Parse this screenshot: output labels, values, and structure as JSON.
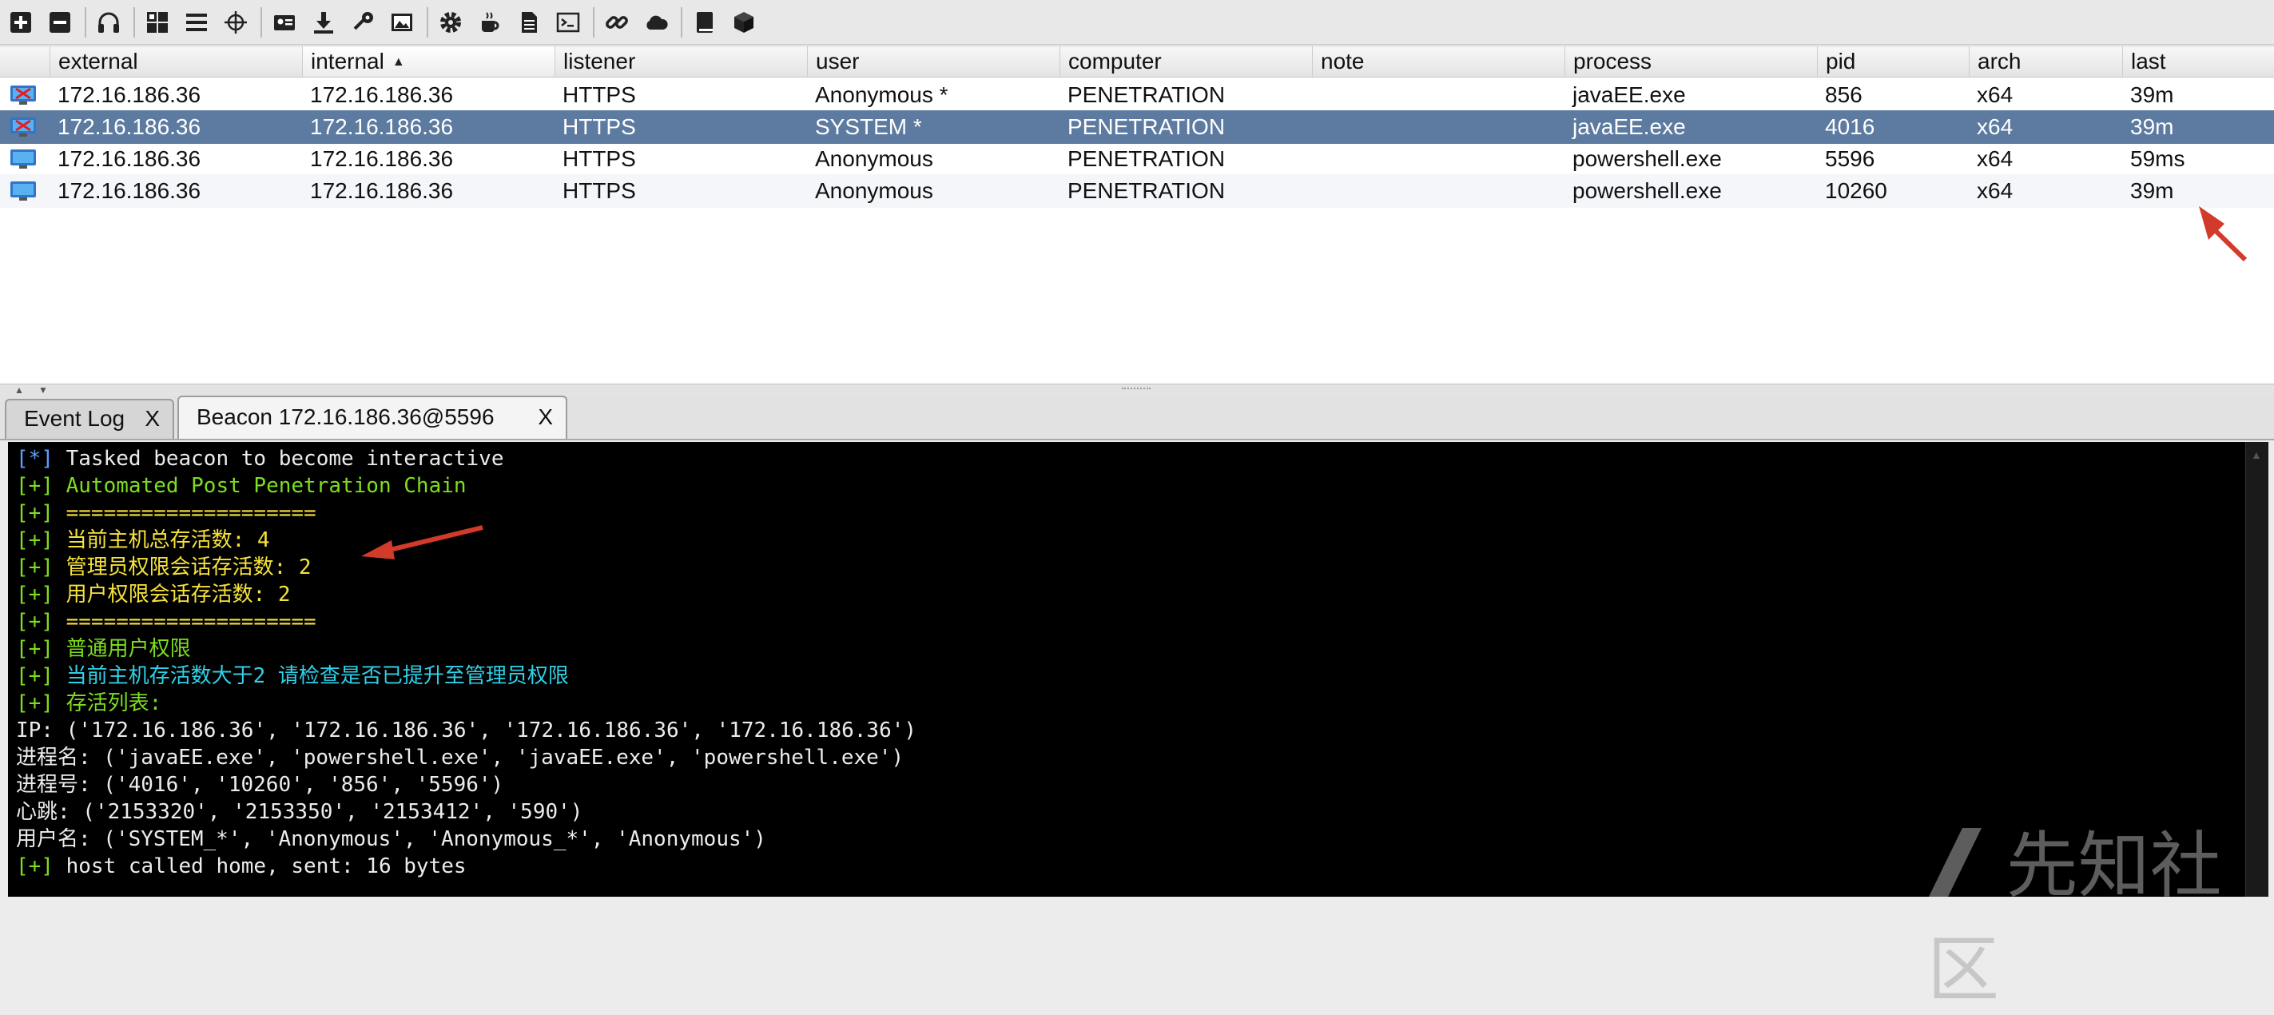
{
  "toolbar": {
    "buttons": [
      {
        "name": "new-connection-icon"
      },
      {
        "name": "disconnect-icon"
      },
      {
        "name": "headphones-icon"
      },
      {
        "name": "pivot-graph-icon"
      },
      {
        "name": "session-table-icon"
      },
      {
        "name": "targets-crosshair-icon"
      },
      {
        "name": "credentials-icon"
      },
      {
        "name": "downloads-icon"
      },
      {
        "name": "keystrokes-key-icon"
      },
      {
        "name": "screenshots-icon"
      },
      {
        "name": "payload-generator-gear-icon"
      },
      {
        "name": "java-cup-icon"
      },
      {
        "name": "document-icon"
      },
      {
        "name": "terminal-icon"
      },
      {
        "name": "link-icon"
      },
      {
        "name": "cloud-icon"
      },
      {
        "name": "book-icon"
      },
      {
        "name": "package-cube-icon"
      }
    ]
  },
  "table": {
    "columns": [
      "external",
      "internal",
      "listener",
      "user",
      "computer",
      "note",
      "process",
      "pid",
      "arch",
      "last"
    ],
    "sorted_column": "internal",
    "rows": [
      {
        "external": "172.16.186.36",
        "internal": "172.16.186.36",
        "listener": "HTTPS",
        "user": "Anonymous *",
        "computer": "PENETRATION",
        "note": "",
        "process": "javaEE.exe",
        "pid": "856",
        "arch": "x64",
        "last": "39m",
        "selected": false,
        "elevated": true
      },
      {
        "external": "172.16.186.36",
        "internal": "172.16.186.36",
        "listener": "HTTPS",
        "user": "SYSTEM *",
        "computer": "PENETRATION",
        "note": "",
        "process": "javaEE.exe",
        "pid": "4016",
        "arch": "x64",
        "last": "39m",
        "selected": true,
        "elevated": true
      },
      {
        "external": "172.16.186.36",
        "internal": "172.16.186.36",
        "listener": "HTTPS",
        "user": "Anonymous",
        "computer": "PENETRATION",
        "note": "",
        "process": "powershell.exe",
        "pid": "5596",
        "arch": "x64",
        "last": "59ms",
        "selected": false,
        "elevated": false
      },
      {
        "external": "172.16.186.36",
        "internal": "172.16.186.36",
        "listener": "HTTPS",
        "user": "Anonymous",
        "computer": "PENETRATION",
        "note": "",
        "process": "powershell.exe",
        "pid": "10260",
        "arch": "x64",
        "last": "39m",
        "selected": false,
        "elevated": false
      }
    ]
  },
  "tabs": [
    {
      "label": "Event Log",
      "close": "X",
      "active": false
    },
    {
      "label": "Beacon 172.16.186.36@5596",
      "close": "X",
      "active": true
    }
  ],
  "console": {
    "lines": [
      {
        "prefix": "[*]",
        "text": " Tasked beacon to become interactive",
        "prefix_color": "blue",
        "text_color": "white"
      },
      {
        "prefix": "[+]",
        "text": " Automated Post Penetration Chain",
        "prefix_color": "green",
        "text_color": "green"
      },
      {
        "prefix": "[+]",
        "text": " ====================",
        "prefix_color": "green",
        "text_color": "yellow"
      },
      {
        "prefix": "[+]",
        "text": " 当前主机总存活数: 4",
        "prefix_color": "green",
        "text_color": "yellow"
      },
      {
        "prefix": "[+]",
        "text": " 管理员权限会话存活数: 2",
        "prefix_color": "green",
        "text_color": "yellow"
      },
      {
        "prefix": "[+]",
        "text": " 用户权限会话存活数: 2",
        "prefix_color": "green",
        "text_color": "yellow"
      },
      {
        "prefix": "[+]",
        "text": " ====================",
        "prefix_color": "green",
        "text_color": "yellow"
      },
      {
        "prefix": "[+]",
        "text": " 普通用户权限",
        "prefix_color": "green",
        "text_color": "green"
      },
      {
        "prefix": "[+]",
        "text": " 当前主机存活数大于2 请检查是否已提升至管理员权限",
        "prefix_color": "green",
        "text_color": "cyan"
      },
      {
        "prefix": "[+]",
        "text": " 存活列表:",
        "prefix_color": "green",
        "text_color": "green"
      },
      {
        "prefix": "",
        "text": "IP: ('172.16.186.36', '172.16.186.36', '172.16.186.36', '172.16.186.36')",
        "prefix_color": "white",
        "text_color": "white"
      },
      {
        "prefix": "",
        "text": "进程名: ('javaEE.exe', 'powershell.exe', 'javaEE.exe', 'powershell.exe')",
        "prefix_color": "white",
        "text_color": "white"
      },
      {
        "prefix": "",
        "text": "进程号: ('4016', '10260', '856', '5596')",
        "prefix_color": "white",
        "text_color": "white"
      },
      {
        "prefix": "",
        "text": "心跳: ('2153320', '2153350', '2153412', '590')",
        "prefix_color": "white",
        "text_color": "white"
      },
      {
        "prefix": "",
        "text": "用户名: ('SYSTEM_*', 'Anonymous', 'Anonymous_*', 'Anonymous')",
        "prefix_color": "white",
        "text_color": "white"
      },
      {
        "prefix": "[+]",
        "text": " host called home, sent: 16 bytes",
        "prefix_color": "green",
        "text_color": "white"
      }
    ]
  },
  "watermark": "先知社区",
  "colors": {
    "selected_row": "#5d7ba0",
    "annotation_arrow": "#d23a2a",
    "console_bg": "#000000"
  }
}
